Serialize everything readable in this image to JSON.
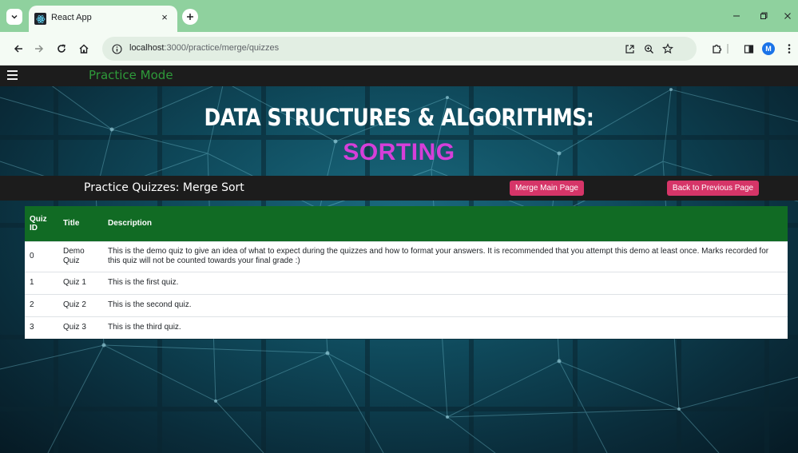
{
  "browser": {
    "tab_title": "React App",
    "tab_close": "×",
    "new_tab": "+",
    "url_host": "localhost",
    "url_path": ":3000/practice/merge/quizzes",
    "profile_initial": "M"
  },
  "app": {
    "mode_title": "Practice Mode",
    "hero_title": "DATA STRUCTURES & ALGORITHMS:",
    "hero_subtitle": "SORTING",
    "subtitle_color": "#d63fd9",
    "accent_color": "#116b24",
    "button_color": "#d63568"
  },
  "quiz_bar": {
    "title": "Practice Quizzes: Merge Sort",
    "merge_main_label": "Merge Main Page",
    "back_label": "Back to Previous Page"
  },
  "table": {
    "headers": [
      "Quiz ID",
      "Title",
      "Description"
    ],
    "rows": [
      {
        "id": "0",
        "title": "Demo Quiz",
        "description": "This is the demo quiz to give an idea of what to expect during the quizzes and how to format your answers. It is recommended that you attempt this demo at least once. Marks recorded for this quiz will not be counted towards your final grade :)"
      },
      {
        "id": "1",
        "title": "Quiz 1",
        "description": "This is the first quiz."
      },
      {
        "id": "2",
        "title": "Quiz 2",
        "description": "This is the second quiz."
      },
      {
        "id": "3",
        "title": "Quiz 3",
        "description": "This is the third quiz."
      }
    ]
  }
}
